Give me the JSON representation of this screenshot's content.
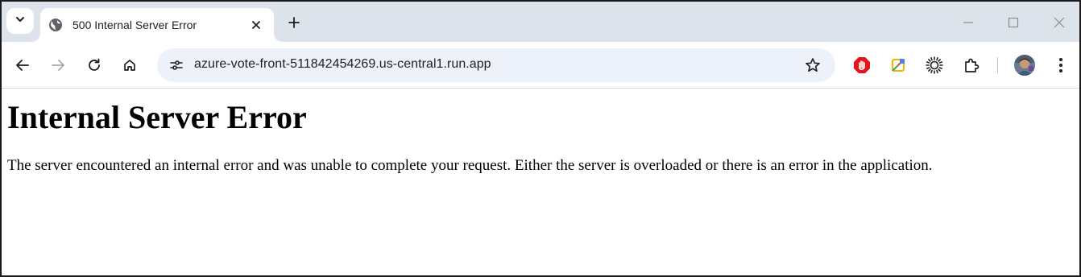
{
  "browser": {
    "tab": {
      "title": "500 Internal Server Error",
      "favicon": "globe-icon"
    },
    "new_tab_icon": "plus-icon",
    "tab_search_icon": "chevron-down-icon",
    "window_controls": [
      "minimize-icon",
      "maximize-icon",
      "close-icon"
    ],
    "toolbar": {
      "back_icon": "arrow-left-icon",
      "forward_icon": "arrow-right-icon",
      "reload_icon": "reload-icon",
      "home_icon": "home-icon",
      "url": "azure-vote-front-511842454269.us-central1.run.app",
      "site_info_icon": "tune-icon",
      "bookmark_icon": "star-icon"
    },
    "extensions": [
      "stop-hand-icon",
      "color-picker-icon",
      "sunburst-icon",
      "puzzle-icon"
    ],
    "menu_icon": "kebab-menu-icon",
    "colors": {
      "tabstrip_bg": "#dde3ea",
      "omnibox_bg": "#edf2fa",
      "ext_red": "#e4141b"
    }
  },
  "page": {
    "heading": "Internal Server Error",
    "message": "The server encountered an internal error and was unable to complete your request. Either the server is overloaded or there is an error in the application."
  }
}
